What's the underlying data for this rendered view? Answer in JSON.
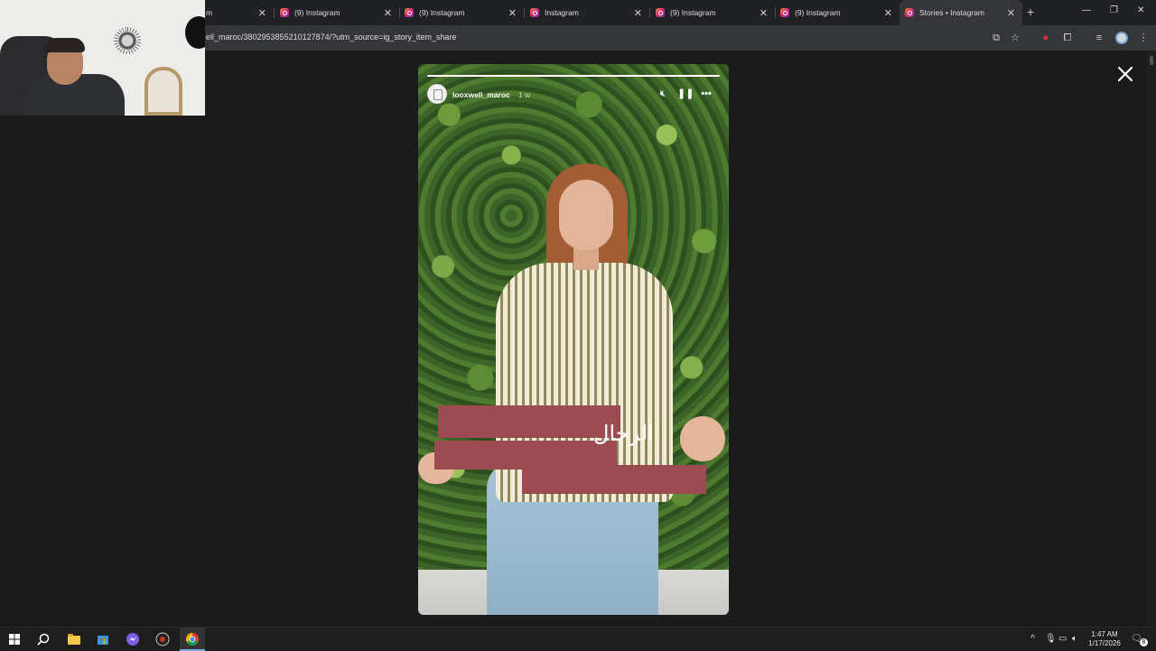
{
  "browser": {
    "tabs": [
      {
        "label": "m",
        "active": false
      },
      {
        "label": "(9) Instagram",
        "active": false
      },
      {
        "label": "(9) Instagram",
        "active": false
      },
      {
        "label": "Instagram",
        "active": false
      },
      {
        "label": "(9) Instagram",
        "active": false
      },
      {
        "label": "(9) Instagram",
        "active": false
      },
      {
        "label": "Stories • Instagram",
        "active": true
      }
    ],
    "url": "ell_maroc/3802953855210127874/?utm_source=ig_story_item_share"
  },
  "story": {
    "username": "looxwell_maroc",
    "age": "1 w",
    "caption": "الرجال",
    "progress_fraction": 1.0
  },
  "taskbar": {
    "time": "1:47 AM",
    "date": "1/17/2026",
    "notification_count": "8"
  },
  "icons": {
    "close": "close-icon",
    "mute": "mute-icon",
    "pause": "pause-icon",
    "more": "more-icon"
  }
}
